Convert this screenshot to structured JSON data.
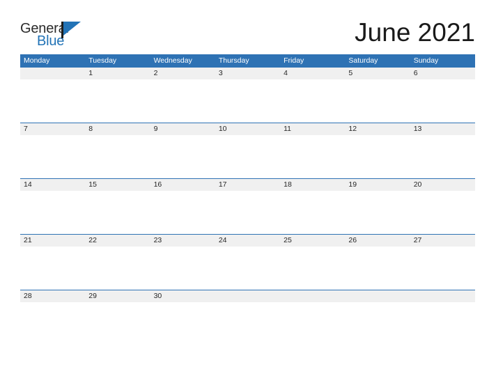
{
  "brand": {
    "name_part_1": "General",
    "name_part_2": "Blue",
    "mark_icon": "triangle-flag-icon",
    "color_dark": "#2b2b2b",
    "color_blue": "#2273b6"
  },
  "header": {
    "title": "June 2021"
  },
  "calendar": {
    "accent_color": "#2e72b4",
    "number_band_color": "#f0f0f0",
    "weekdays": [
      "Monday",
      "Tuesday",
      "Wednesday",
      "Thursday",
      "Friday",
      "Saturday",
      "Sunday"
    ],
    "weeks": [
      [
        "",
        "1",
        "2",
        "3",
        "4",
        "5",
        "6"
      ],
      [
        "7",
        "8",
        "9",
        "10",
        "11",
        "12",
        "13"
      ],
      [
        "14",
        "15",
        "16",
        "17",
        "18",
        "19",
        "20"
      ],
      [
        "21",
        "22",
        "23",
        "24",
        "25",
        "26",
        "27"
      ],
      [
        "28",
        "29",
        "30",
        "",
        "",
        "",
        ""
      ]
    ]
  }
}
